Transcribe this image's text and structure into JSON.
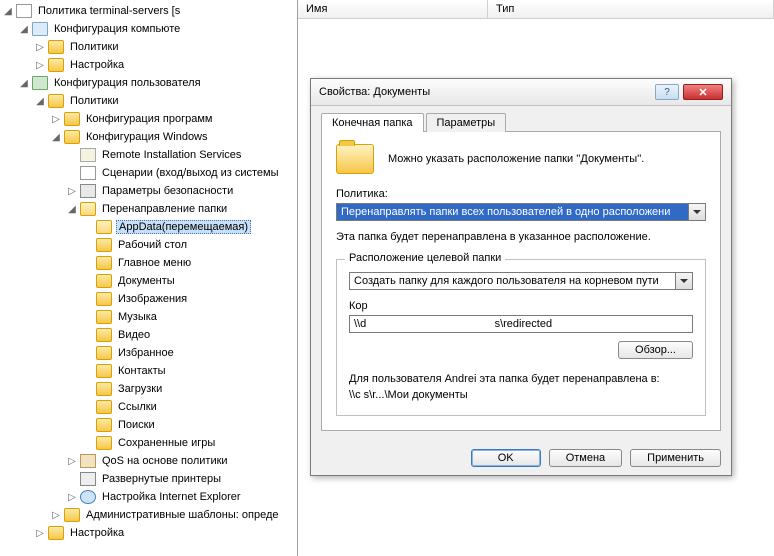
{
  "listHeader": {
    "name": "Имя",
    "type": "Тип"
  },
  "tree": {
    "root": "Политика terminal-servers [s",
    "compConfig": "Конфигурация компьюте",
    "policies": "Политики",
    "settings": "Настройка",
    "userConfig": "Конфигурация пользователя",
    "progConfig": "Конфигурация программ",
    "winConfig": "Конфигурация Windows",
    "ris": "Remote Installation Services",
    "scripts": "Сценарии (вход/выход из системы",
    "secParams": "Параметры безопасности",
    "folderRedir": "Перенаправление папки",
    "appdata": "AppData(перемещаемая)",
    "desktop": "Рабочий стол",
    "startmenu": "Главное меню",
    "documents": "Документы",
    "pictures": "Изображения",
    "music": "Музыка",
    "video": "Видео",
    "favorites": "Избранное",
    "contacts": "Контакты",
    "downloads": "Загрузки",
    "links": "Ссылки",
    "searches": "Поиски",
    "savedgames": "Сохраненные игры",
    "qos": "QoS на основе политики",
    "printers": "Развернутые принтеры",
    "ie": "Настройка Internet Explorer",
    "admTemplates": "Административные шаблоны: опреде"
  },
  "dialog": {
    "title": "Свойства: Документы",
    "tabTarget": "Конечная папка",
    "tabParams": "Параметры",
    "hint": "Можно указать расположение папки ''Документы''.",
    "policyLabel": "Политика:",
    "policyValue": "Перенаправлять папки всех пользователей в одно расположени",
    "note": "Эта папка будет перенаправлена в указанное расположение.",
    "groupTitle": "Расположение целевой папки",
    "locCombo": "Создать папку для каждого пользователя на корневом пути",
    "rootLabel": "Кор",
    "rootValue": "\\\\d                                          s\\redirected",
    "browse": "Обзор...",
    "redirectDesc": "Для пользователя Andrei эта папка будет перенаправлена в:",
    "redirectPath": "\\\\c                                       s\\r...\\Мои документы",
    "ok": "OK",
    "cancel": "Отмена",
    "apply": "Применить"
  }
}
